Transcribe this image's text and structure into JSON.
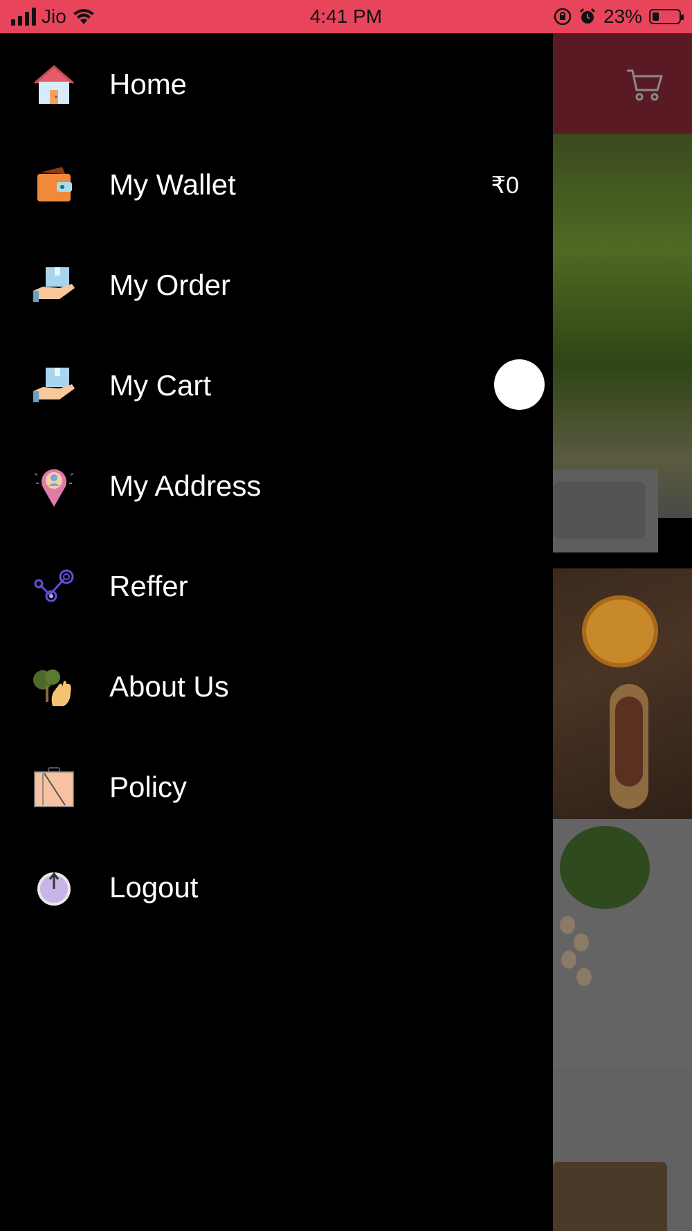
{
  "status_bar": {
    "carrier": "Jio",
    "time": "4:41 PM",
    "battery": "23%",
    "battery_level_percent": 23,
    "bg_color": "#e8445c"
  },
  "background_app": {
    "header_color": "#5a1a24",
    "cart_icon": "shopping-cart-icon"
  },
  "drawer": {
    "items": [
      {
        "label": "Home",
        "icon": "home-icon"
      },
      {
        "label": "My Wallet",
        "icon": "wallet-icon",
        "value": "₹0"
      },
      {
        "label": "My Order",
        "icon": "order-box-icon"
      },
      {
        "label": "My Cart",
        "icon": "cart-box-icon"
      },
      {
        "label": "My Address",
        "icon": "location-pin-icon"
      },
      {
        "label": "Reffer",
        "icon": "share-nodes-icon"
      },
      {
        "label": "About Us",
        "icon": "about-tree-hand-icon"
      },
      {
        "label": "Policy",
        "icon": "policy-document-icon"
      },
      {
        "label": "Logout",
        "icon": "power-icon"
      }
    ]
  }
}
